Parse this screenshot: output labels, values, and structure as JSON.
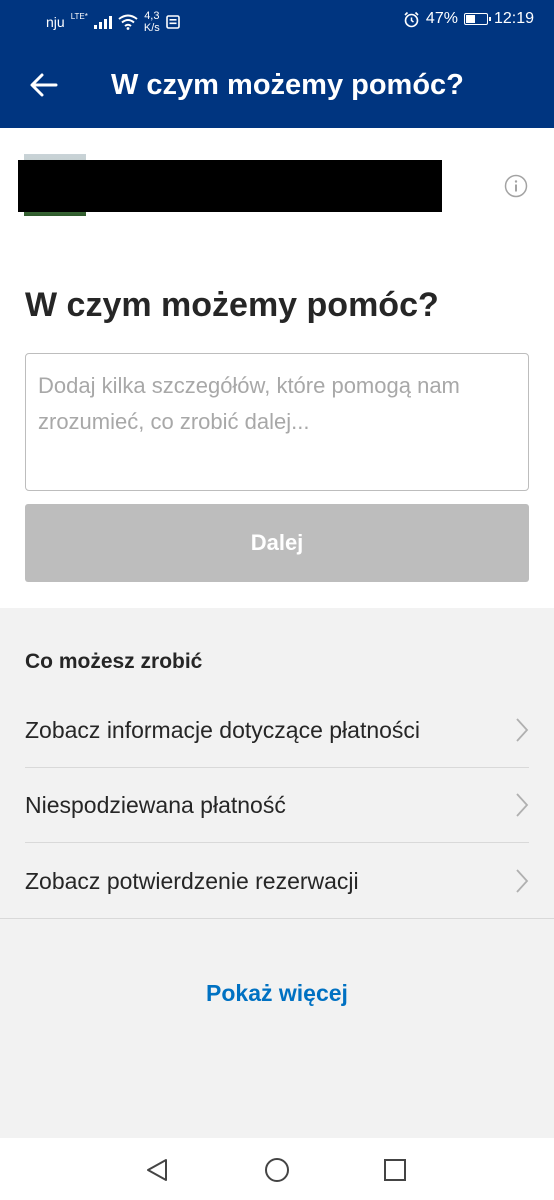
{
  "status_bar": {
    "carrier": "nju",
    "network_type": "LTE*",
    "speed_value": "4,3",
    "speed_unit": "K/s",
    "battery_percent": "47%",
    "battery_level": 0.47,
    "time": "12:19",
    "icons": [
      "signal-icon",
      "wifi-icon",
      "notification-icon",
      "alarm-icon",
      "battery-icon"
    ]
  },
  "app_bar": {
    "title": "W czym możemy pomóc?",
    "back_icon": "arrow-left-icon"
  },
  "booking": {
    "info_icon": "info-icon"
  },
  "help": {
    "heading": "W czym możemy pomóc?",
    "details_placeholder": "Dodaj kilka szczegółów, które pomogą nam zrozumieć, co zrobić dalej...",
    "details_value": "",
    "next_button": "Dalej"
  },
  "actions": {
    "title": "Co możesz zrobić",
    "items": [
      {
        "label": "Zobacz informacje dotyczące płatności"
      },
      {
        "label": "Niespodziewana płatność"
      },
      {
        "label": "Zobacz potwierdzenie rezerwacji"
      }
    ],
    "show_more": "Pokaż więcej"
  },
  "colors": {
    "brand_blue": "#003580",
    "link_blue": "#0071c2",
    "disabled_button": "#bdbdbd",
    "background": "#f2f2f2"
  },
  "nav_bar": {
    "icons": [
      "back-triangle-icon",
      "home-circle-icon",
      "recents-square-icon"
    ]
  }
}
